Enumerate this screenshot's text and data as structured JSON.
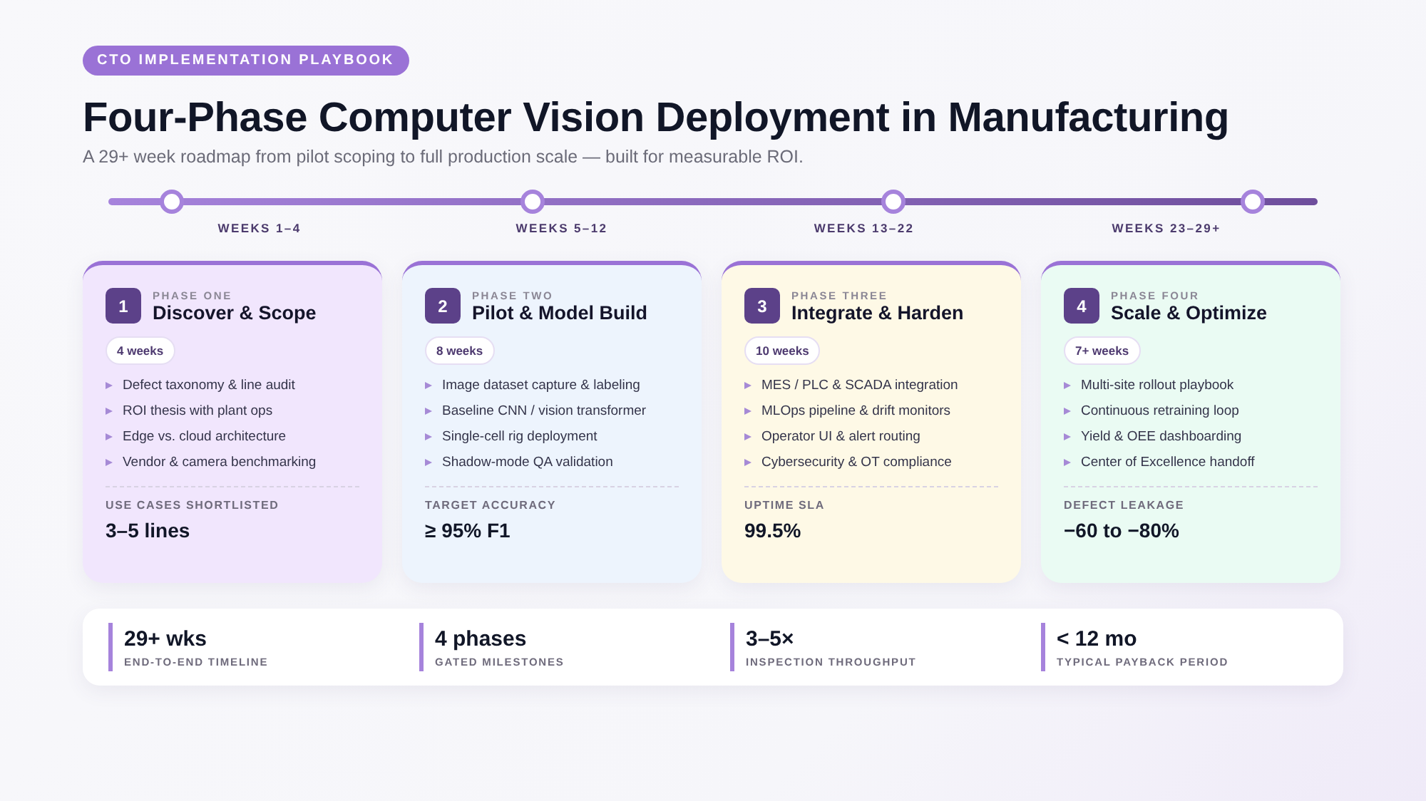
{
  "eyebrow": "CTO IMPLEMENTATION PLAYBOOK",
  "title": "Four-Phase Computer Vision Deployment in Manufacturing",
  "subtitle": "A 29+ week roadmap from pilot scoping to full production scale — built for measurable ROI.",
  "timeline": [
    {
      "label": "WEEKS 1–4"
    },
    {
      "label": "WEEKS 5–12"
    },
    {
      "label": "WEEKS 13–22"
    },
    {
      "label": "WEEKS 23–29+"
    }
  ],
  "phases": [
    {
      "number": "1",
      "eyebrow": "PHASE ONE",
      "title": "Discover & Scope",
      "duration": "4 weeks",
      "color": "#f1e6fd",
      "items": [
        "Defect taxonomy & line audit",
        "ROI thesis with plant ops",
        "Edge vs. cloud architecture",
        "Vendor & camera benchmarking"
      ],
      "metric_label": "USE CASES SHORTLISTED",
      "metric_value": "3–5 lines"
    },
    {
      "number": "2",
      "eyebrow": "PHASE TWO",
      "title": "Pilot & Model Build",
      "duration": "8 weeks",
      "color": "#edf4fd",
      "items": [
        "Image dataset capture & labeling",
        "Baseline CNN / vision transformer",
        "Single-cell rig deployment",
        "Shadow-mode QA validation"
      ],
      "metric_label": "TARGET ACCURACY",
      "metric_value": "≥ 95% F1"
    },
    {
      "number": "3",
      "eyebrow": "PHASE THREE",
      "title": "Integrate & Harden",
      "duration": "10 weeks",
      "color": "#fef9e6",
      "items": [
        "MES / PLC & SCADA integration",
        "MLOps pipeline & drift monitors",
        "Operator UI & alert routing",
        "Cybersecurity & OT compliance"
      ],
      "metric_label": "UPTIME SLA",
      "metric_value": "99.5%"
    },
    {
      "number": "4",
      "eyebrow": "PHASE FOUR",
      "title": "Scale & Optimize",
      "duration": "7+ weeks",
      "color": "#eafbf3",
      "items": [
        "Multi-site rollout playbook",
        "Continuous retraining loop",
        "Yield & OEE dashboarding",
        "Center of Excellence handoff"
      ],
      "metric_label": "DEFECT LEAKAGE",
      "metric_value": "−60 to −80%"
    }
  ],
  "stats": [
    {
      "value": "29+ wks",
      "label": "END-TO-END TIMELINE"
    },
    {
      "value": "4 phases",
      "label": "GATED MILESTONES"
    },
    {
      "value": "3–5×",
      "label": "INSPECTION THROUGHPUT"
    },
    {
      "value": "< 12 mo",
      "label": "TYPICAL PAYBACK PERIOD"
    }
  ]
}
